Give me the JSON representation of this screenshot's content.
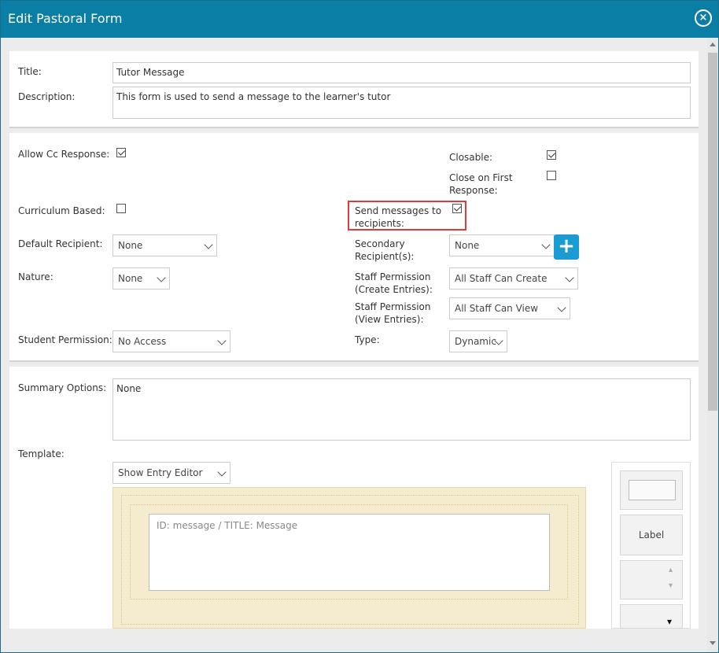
{
  "dialog": {
    "title": "Edit Pastoral Form",
    "close_symbol": "×"
  },
  "form": {
    "title_label": "Title:",
    "title_value": "Tutor Message",
    "description_label": "Description:",
    "description_value": "This form is used to send a message to the learner's tutor",
    "allow_cc_label": "Allow Cc Response:",
    "allow_cc_checked": true,
    "closable_label": "Closable:",
    "closable_checked": true,
    "close_first_label_1": "Close on First",
    "close_first_label_2": "Response:",
    "close_first_checked": false,
    "curriculum_label": "Curriculum Based:",
    "curriculum_checked": false,
    "send_msg_label_1": "Send messages to",
    "send_msg_label_2": "recipients:",
    "send_msg_checked": true,
    "default_recipient_label": "Default Recipient:",
    "default_recipient_value": "None",
    "secondary_label_1": "Secondary",
    "secondary_label_2": "Recipient(s):",
    "secondary_value": "None",
    "add_symbol": "+",
    "nature_label": "Nature:",
    "nature_value": "None",
    "staff_create_label_1": "Staff Permission",
    "staff_create_label_2": "(Create Entries):",
    "staff_create_value": "All Staff Can Create",
    "staff_view_label_1": "Staff Permission",
    "staff_view_label_2": "(View Entries):",
    "staff_view_value": "All Staff Can View",
    "student_perm_label": "Student Permission:",
    "student_perm_value": "No Access",
    "type_label": "Type:",
    "type_value": "Dynamic",
    "summary_label": "Summary Options:",
    "summary_value": "None",
    "template_label": "Template:",
    "template_mode_value": "Show Entry Editor",
    "template_field_text": "ID: message  /  TITLE: Message"
  },
  "palette": {
    "label_item": "Label",
    "dropdown_symbol": "▾",
    "spin_up": "▴",
    "spin_down": "▾"
  },
  "colors": {
    "titlebar": "#0a7ea5",
    "highlight": "#e0393e",
    "add_button": "#1b9bd1",
    "template_bg": "#f5ecd0"
  }
}
